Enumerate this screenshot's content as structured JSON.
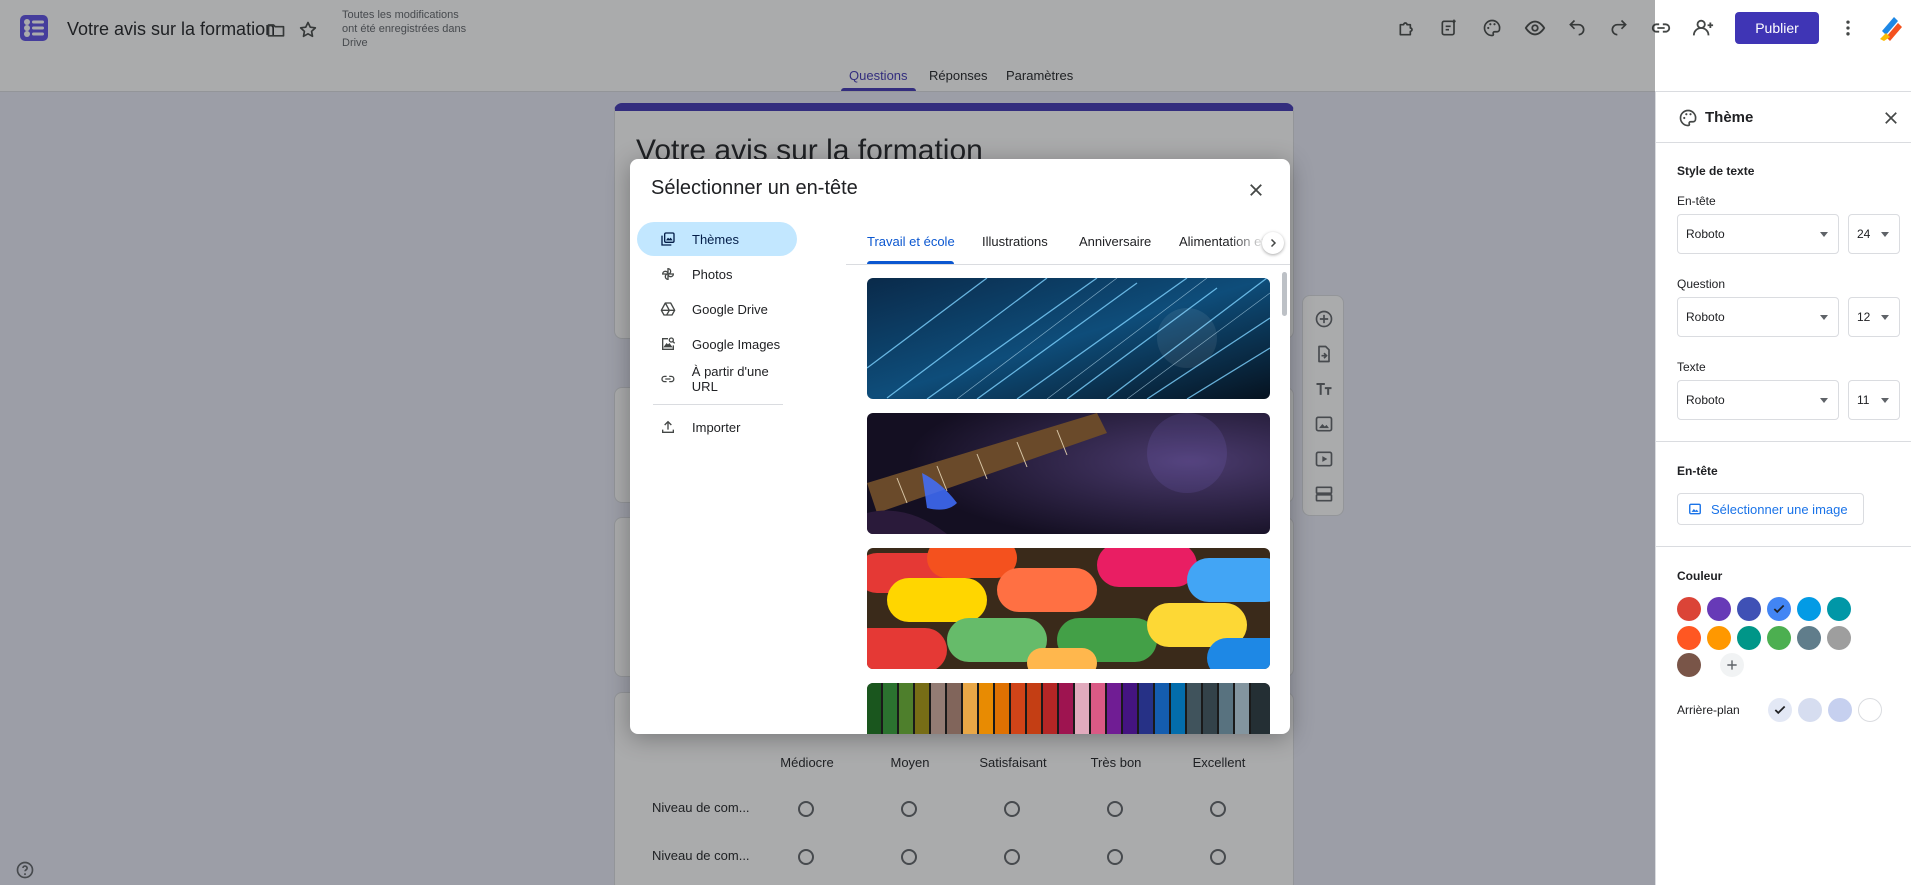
{
  "app": {
    "doc_title": "Votre avis sur la formation",
    "save_status": "Toutes les modifications ont été enregistrées dans Drive",
    "publish_label": "Publier",
    "tabs": [
      {
        "label": "Questions",
        "active": true
      },
      {
        "label": "Réponses",
        "active": false
      },
      {
        "label": "Paramètres",
        "active": false
      }
    ],
    "toolbar_icons": [
      "add-on-icon",
      "customize-icon",
      "palette-icon",
      "preview-eye-icon",
      "undo-icon",
      "redo-icon",
      "link-icon",
      "add-collaborator-icon"
    ],
    "accent_color": "#3f35b5"
  },
  "form": {
    "title": "Votre avis sur la formation",
    "grid_columns": [
      "Médiocre",
      "Moyen",
      "Satisfaisant",
      "Très bon",
      "Excellent"
    ],
    "grid_rows": [
      "Niveau de com...",
      "Niveau de com..."
    ],
    "floating_toolbar": [
      "add-question-icon",
      "import-questions-icon",
      "add-title-icon",
      "add-image-icon",
      "add-video-icon",
      "add-section-icon"
    ]
  },
  "dialog": {
    "title": "Sélectionner un en-tête",
    "nav": [
      {
        "label": "Thèmes",
        "icon": "themes-icon",
        "active": true
      },
      {
        "label": "Photos",
        "icon": "photos-icon",
        "active": false
      },
      {
        "label": "Google Drive",
        "icon": "drive-icon",
        "active": false
      },
      {
        "label": "Google Images",
        "icon": "image-search-icon",
        "active": false
      },
      {
        "label": "À partir d'une URL",
        "icon": "link-icon",
        "active": false
      },
      {
        "label": "Importer",
        "icon": "upload-icon",
        "active": false
      }
    ],
    "categories": [
      {
        "label": "Travail et école",
        "active": true
      },
      {
        "label": "Illustrations",
        "active": false
      },
      {
        "label": "Anniversaire",
        "active": false
      },
      {
        "label": "Alimentation et boissons",
        "active": false
      }
    ],
    "thumbnails": [
      "blue-fiber-optic-lights",
      "guitar-neck-purple-light",
      "colorful-candy-pills",
      "colored-pencils-rainbow"
    ]
  },
  "theme_panel": {
    "title": "Thème",
    "text_style_label": "Style de texte",
    "header_label": "En-tête",
    "header_font": "Roboto",
    "header_size": "24",
    "question_label": "Question",
    "question_font": "Roboto",
    "question_size": "12",
    "text_label": "Texte",
    "text_font": "Roboto",
    "text_size": "11",
    "header_section_label": "En-tête",
    "select_image_label": "Sélectionner une image",
    "color_label": "Couleur",
    "colors": [
      "#db4437",
      "#673ab7",
      "#3f51b5",
      "#4285f4",
      "#039be5",
      "#0097a7",
      "#ff5722",
      "#ff9800",
      "#009688",
      "#4caf50",
      "#607d8b",
      "#9e9e9e",
      "#795548"
    ],
    "selected_color": "#4285f4",
    "background_label": "Arrière-plan",
    "backgrounds": [
      "#e3e8f5",
      "#d6ddf0",
      "#c6d0ef",
      "#ffffff"
    ]
  }
}
